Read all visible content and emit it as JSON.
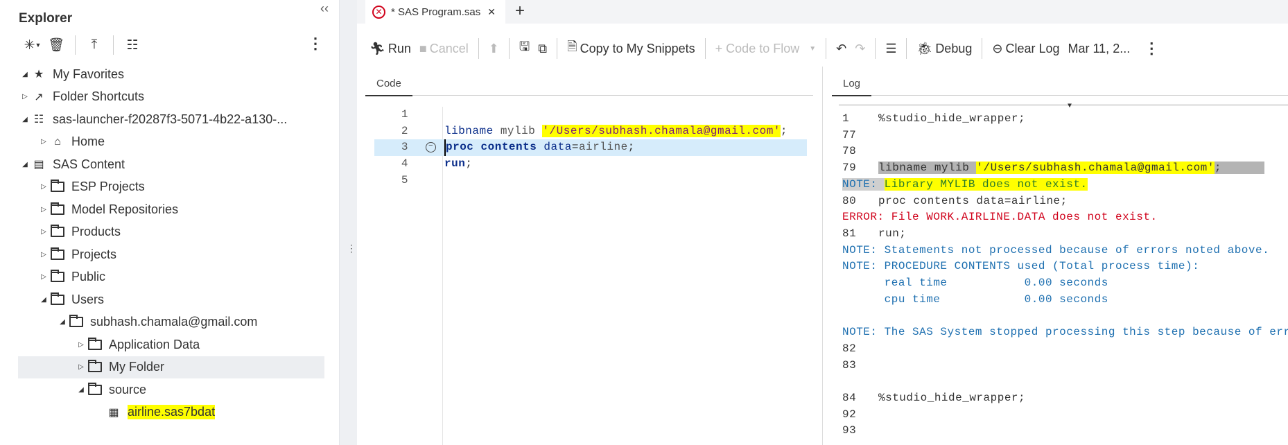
{
  "explorer": {
    "title": "Explorer",
    "collapse_icon": "double-chevron-left",
    "toolbar": [
      "new-item-icon",
      "delete-icon",
      "upload-icon",
      "properties-icon",
      "more-icon"
    ],
    "tree": [
      {
        "label": "My Favorites",
        "level": 0,
        "state": "expanded",
        "icon": "favorites-folder"
      },
      {
        "label": "Folder Shortcuts",
        "level": 0,
        "state": "collapsed",
        "icon": "shortcut-folder"
      },
      {
        "label": "sas-launcher-f20287f3-5071-4b22-a130-...",
        "level": 0,
        "state": "expanded",
        "icon": "server"
      },
      {
        "label": "Home",
        "level": 1,
        "state": "collapsed",
        "icon": "home-folder"
      },
      {
        "label": "SAS Content",
        "level": 0,
        "state": "expanded",
        "icon": "content-folder"
      },
      {
        "label": "ESP Projects",
        "level": 1,
        "state": "collapsed",
        "icon": "folder"
      },
      {
        "label": "Model Repositories",
        "level": 1,
        "state": "collapsed",
        "icon": "folder"
      },
      {
        "label": "Products",
        "level": 1,
        "state": "collapsed",
        "icon": "folder"
      },
      {
        "label": "Projects",
        "level": 1,
        "state": "collapsed",
        "icon": "folder"
      },
      {
        "label": "Public",
        "level": 1,
        "state": "collapsed",
        "icon": "folder"
      },
      {
        "label": "Users",
        "level": 1,
        "state": "expanded",
        "icon": "folder"
      },
      {
        "label": "subhash.chamala@gmail.com",
        "level": 2,
        "state": "expanded",
        "icon": "folder"
      },
      {
        "label": "Application Data",
        "level": 3,
        "state": "collapsed",
        "icon": "folder"
      },
      {
        "label": "My Folder",
        "level": 3,
        "state": "collapsed",
        "icon": "folder",
        "selected": true
      },
      {
        "label": "source",
        "level": 3,
        "state": "expanded",
        "icon": "folder"
      },
      {
        "label": "airline.sas7bdat",
        "level": 4,
        "state": "leaf",
        "icon": "dataset",
        "highlighted": true
      }
    ]
  },
  "tabs": [
    {
      "label": "* SAS Program.sas",
      "status": "error"
    }
  ],
  "toolbar": {
    "run": "Run",
    "cancel": "Cancel",
    "copy_snippets": "Copy to My Snippets",
    "code_to_flow": "+ Code to Flow",
    "debug": "Debug",
    "clear_log": "Clear Log",
    "timestamp": "Mar 11, 2..."
  },
  "code": {
    "header": "Code",
    "lines": [
      {
        "n": "1",
        "tokens": []
      },
      {
        "n": "2",
        "tokens": [
          [
            "kw",
            "libname"
          ],
          [
            "id",
            " mylib "
          ],
          [
            "str hl",
            "'/Users/subhash.chamala@gmail.com'"
          ],
          [
            "op",
            ";"
          ]
        ]
      },
      {
        "n": "3",
        "current": true,
        "tokens": [
          [
            "kwb",
            "proc contents"
          ],
          [
            "kw",
            " data"
          ],
          [
            "op",
            "="
          ],
          [
            "id",
            "airline"
          ],
          [
            "op",
            ";"
          ]
        ]
      },
      {
        "n": "4",
        "tokens": [
          [
            "kwb",
            "run"
          ],
          [
            "op",
            ";"
          ]
        ]
      },
      {
        "n": "5",
        "tokens": []
      }
    ]
  },
  "log": {
    "header": "Log",
    "lines": [
      {
        "n": "1",
        "text": "%studio_hide_wrapper;",
        "cls": ""
      },
      {
        "n": "77",
        "text": "",
        "cls": ""
      },
      {
        "n": "78",
        "text": "",
        "cls": ""
      },
      {
        "n": "79",
        "text": "libname mylib '/Users/subhash.chamala@gmail.com';",
        "cls": "band"
      },
      {
        "n": "",
        "text": "NOTE: Library MYLIB does not exist.",
        "cls": "note-hl"
      },
      {
        "n": "80",
        "text": "proc contents data=airline;",
        "cls": ""
      },
      {
        "n": "",
        "text": "ERROR: File WORK.AIRLINE.DATA does not exist.",
        "cls": "err"
      },
      {
        "n": "81",
        "text": "run;",
        "cls": ""
      },
      {
        "n": "",
        "text": "NOTE: Statements not processed because of errors noted above.",
        "cls": "note"
      },
      {
        "n": "",
        "text": "NOTE: PROCEDURE CONTENTS used (Total process time):",
        "cls": "note"
      },
      {
        "n": "",
        "text": "      real time           0.00 seconds",
        "cls": "note"
      },
      {
        "n": "",
        "text": "      cpu time            0.00 seconds",
        "cls": "note"
      },
      {
        "n": "",
        "text": "",
        "cls": ""
      },
      {
        "n": "",
        "text": "NOTE: The SAS System stopped processing this step because of errors.",
        "cls": "note"
      },
      {
        "n": "82",
        "text": "",
        "cls": ""
      },
      {
        "n": "83",
        "text": "",
        "cls": ""
      },
      {
        "n": "",
        "text": "",
        "cls": ""
      },
      {
        "n": "84",
        "text": "%studio_hide_wrapper;",
        "cls": ""
      },
      {
        "n": "92",
        "text": "",
        "cls": ""
      },
      {
        "n": "93",
        "text": "",
        "cls": ""
      }
    ]
  },
  "colors": {
    "highlight": "#ffff00",
    "note": "#1d6fb0",
    "error": "#d0021b",
    "keyword": "#0b2e8a"
  }
}
